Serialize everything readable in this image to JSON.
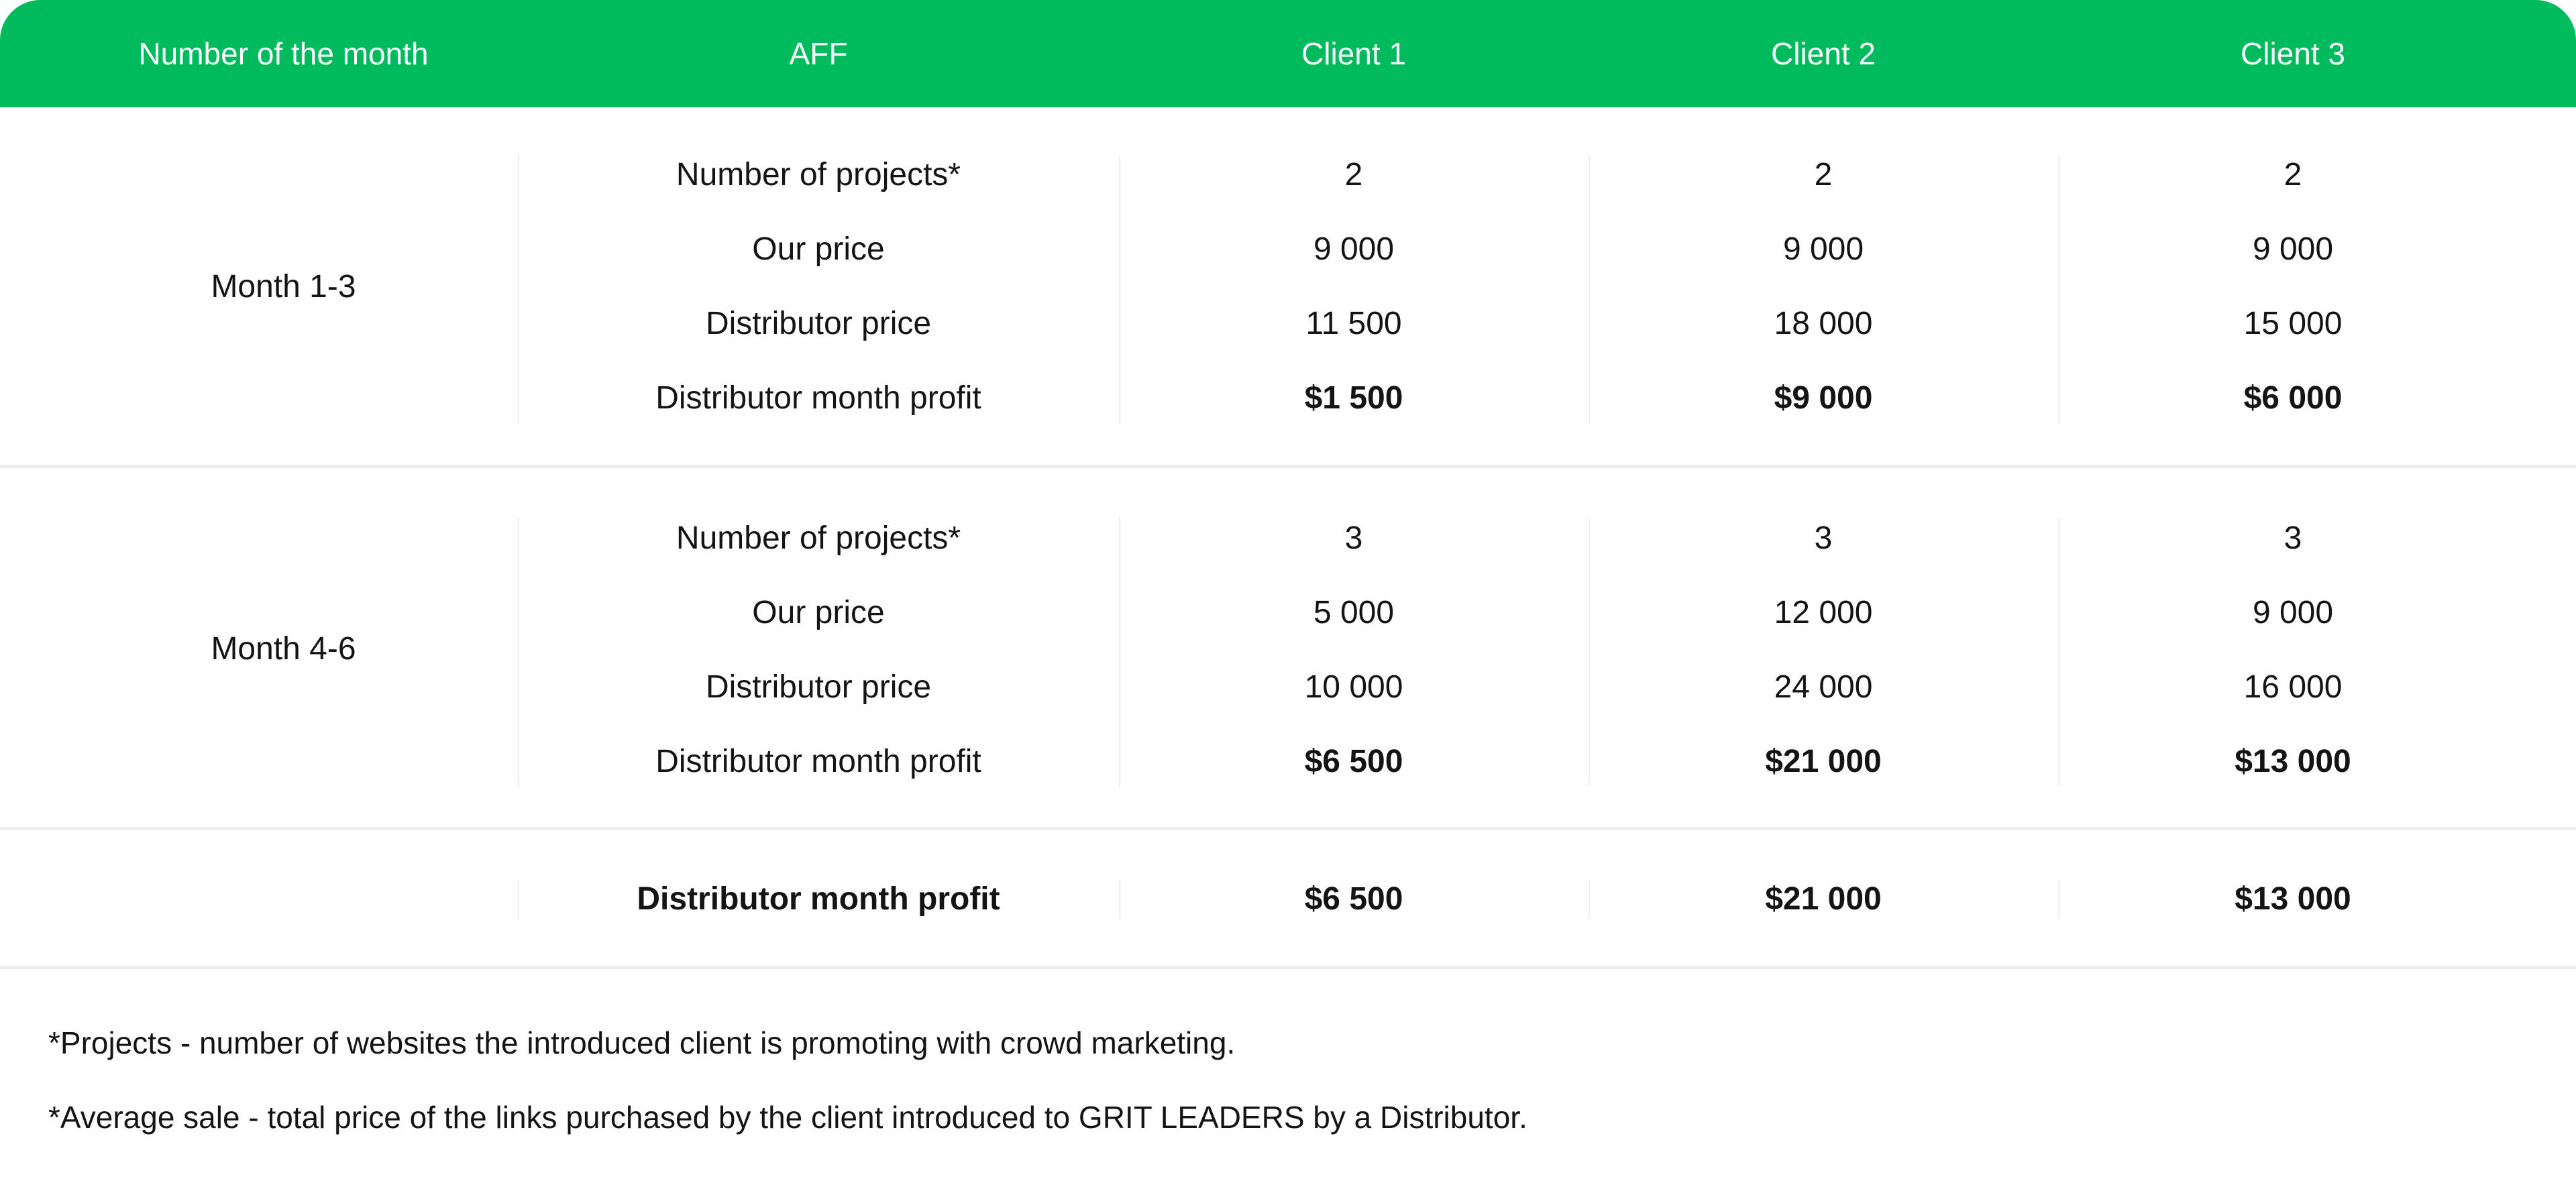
{
  "header": {
    "col_month": "Number of the month",
    "col_aff": "AFF",
    "col_client1": "Client 1",
    "col_client2": "Client 2",
    "col_client3": "Client 3"
  },
  "groups": [
    {
      "month": "Month 1-3",
      "rows": [
        {
          "label": "Number of projects*",
          "client1": "2",
          "client2": "2",
          "client3": "2"
        },
        {
          "label": "Our price",
          "client1": "9 000",
          "client2": "9 000",
          "client3": "9 000"
        },
        {
          "label": "Distributor price",
          "client1": "11 500",
          "client2": "18 000",
          "client3": "15 000"
        },
        {
          "label": "Distributor month profit",
          "client1": "$1 500",
          "client2": "$9 000",
          "client3": "$6 000"
        }
      ]
    },
    {
      "month": "Month 4-6",
      "rows": [
        {
          "label": "Number of projects*",
          "client1": "3",
          "client2": "3",
          "client3": "3"
        },
        {
          "label": "Our price",
          "client1": "5 000",
          "client2": "12 000",
          "client3": "9 000"
        },
        {
          "label": "Distributor price",
          "client1": "10 000",
          "client2": "24 000",
          "client3": "16 000"
        },
        {
          "label": "Distributor month profit",
          "client1": "$6 500",
          "client2": "$21 000",
          "client3": "$13 000"
        }
      ]
    }
  ],
  "total": {
    "label": "Distributor month profit",
    "client1": "$6 500",
    "client2": "$21 000",
    "client3": "$13 000"
  },
  "notes": [
    "*Projects - number of websites the introduced client is promoting with crowd marketing.",
    "*Average sale - total price of the links purchased by the client introduced to GRIT LEADERS by a Distributor."
  ],
  "colors": {
    "header_bg": "#00bb5e",
    "header_text": "#ffffff",
    "divider": "#eeeeee"
  }
}
